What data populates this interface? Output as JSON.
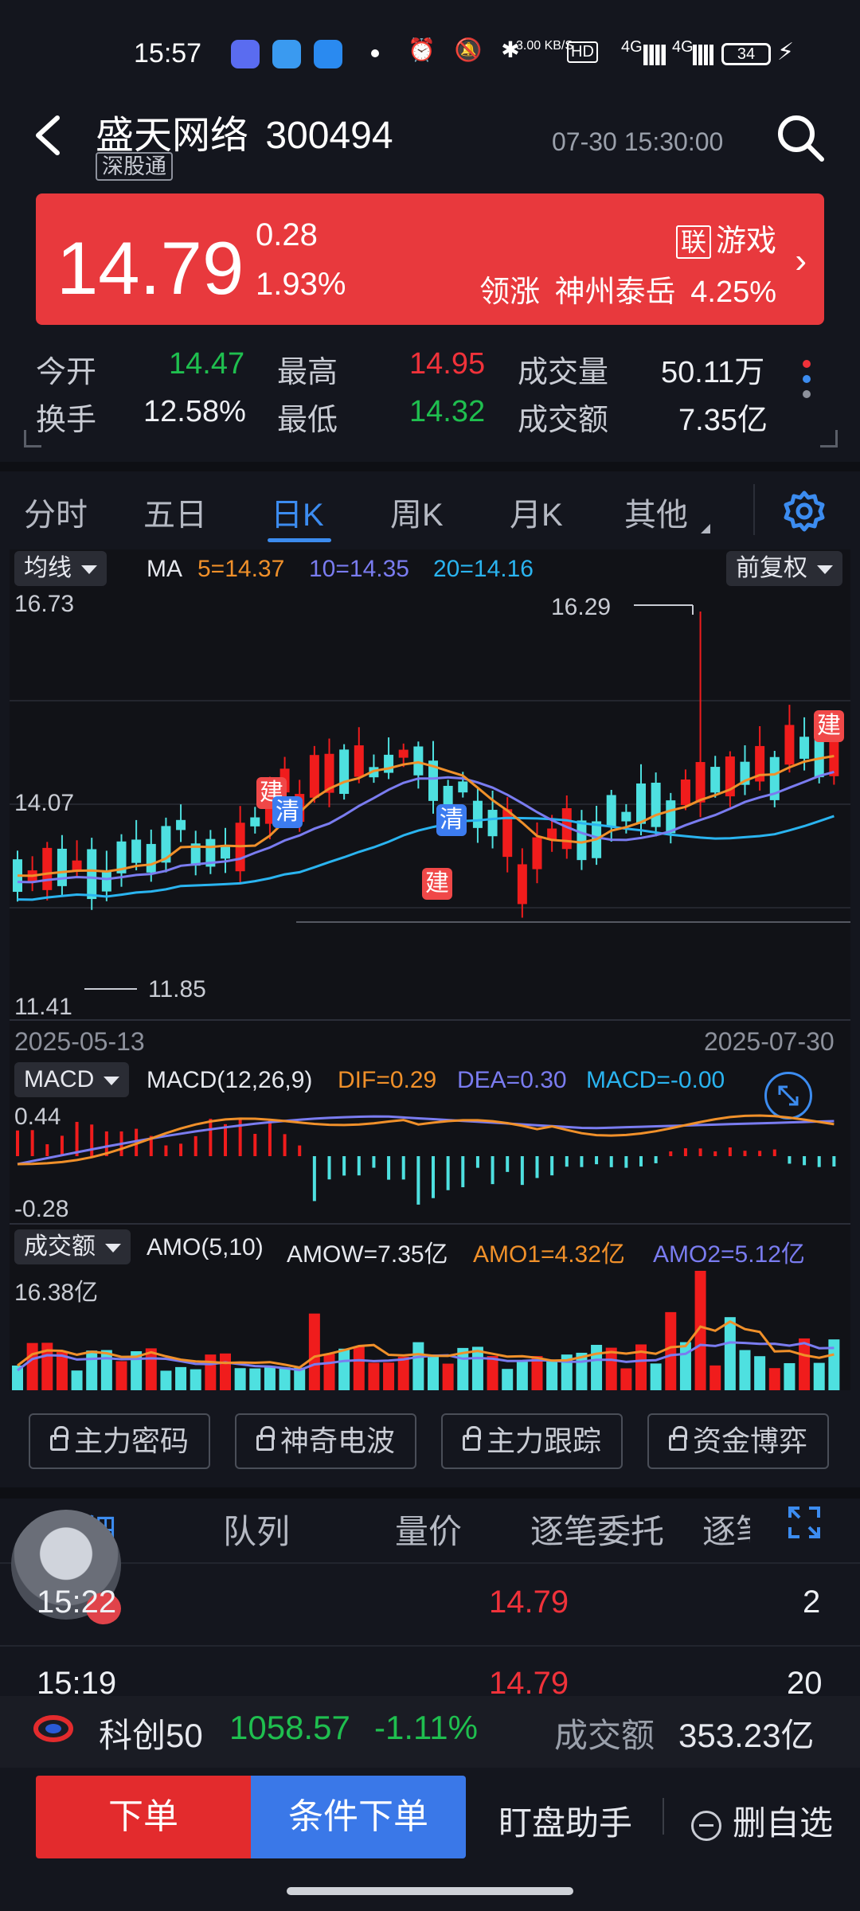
{
  "status_bar": {
    "time": "15:57",
    "net_speed": "3.00 KB/S",
    "hd": "HD",
    "signal1": "4G",
    "signal2": "4G",
    "battery": "34"
  },
  "header": {
    "name": "盛天网络",
    "code": "300494",
    "tag": "深股通",
    "datetime": "07-30 15:30:00"
  },
  "banner": {
    "price": "14.79",
    "change": "0.28",
    "change_pct": "1.93%",
    "sector_badge": "联",
    "sector": "游戏",
    "leader_label": "领涨",
    "leader_name": "神州泰岳",
    "leader_pct": "4.25%",
    "color": "#e8393d"
  },
  "stats": {
    "open_label": "今开",
    "open": "14.47",
    "high_label": "最高",
    "high": "14.95",
    "volume_label": "成交量",
    "volume": "50.11万",
    "turnover_label": "换手",
    "turnover": "12.58%",
    "low_label": "最低",
    "low": "14.32",
    "amount_label": "成交额",
    "amount": "7.35亿"
  },
  "k_tabs": [
    "分时",
    "五日",
    "日K",
    "周K",
    "月K",
    "其他"
  ],
  "k_active": "日K",
  "main_chart": {
    "indicator_select": "均线",
    "ma_label": "MA",
    "ma5": "5=14.37",
    "ma10": "10=14.35",
    "ma20": "20=14.16",
    "adjust_select": "前复权",
    "y_top": "16.73",
    "y_mid": "14.07",
    "y_bottom": "11.41",
    "max_label": "16.29",
    "min_label": "11.85",
    "date_start": "2025-05-13",
    "date_end": "2025-07-30",
    "marker_jian": "建",
    "marker_qing": "清",
    "colors": {
      "up": "#f01c1c",
      "down": "#4ee0e0",
      "ma5": "#f0902a",
      "ma10": "#7a7cf0",
      "ma20": "#2ab4f0"
    }
  },
  "macd_panel": {
    "select": "MACD",
    "params": "MACD(12,26,9)",
    "dif": "DIF=0.29",
    "dea": "DEA=0.30",
    "macd": "MACD=-0.00",
    "y_top": "0.44",
    "y_bottom": "-0.28"
  },
  "amo_panel": {
    "select": "成交额",
    "params": "AMO(5,10)",
    "amow": "AMOW=7.35亿",
    "amo1": "AMO1=4.32亿",
    "amo2": "AMO2=5.12亿",
    "y_top": "16.38亿"
  },
  "features": [
    "主力密码",
    "神奇电波",
    "主力跟踪",
    "资金博弈"
  ],
  "detail_tabs": [
    "明细",
    "队列",
    "量价",
    "逐笔委托",
    "逐笔"
  ],
  "trades": [
    {
      "time": "15:22",
      "price": "14.79",
      "vol": "2"
    },
    {
      "time": "15:19",
      "price": "14.79",
      "vol": "20"
    }
  ],
  "index_bar": {
    "name": "科创50",
    "value": "1058.57",
    "pct": "-1.11%",
    "amount_label": "成交额",
    "amount": "353.23亿"
  },
  "bottom": {
    "order": "下单",
    "cond_order": "条件下单",
    "watch": "盯盘助手",
    "delete": "删自选"
  }
}
